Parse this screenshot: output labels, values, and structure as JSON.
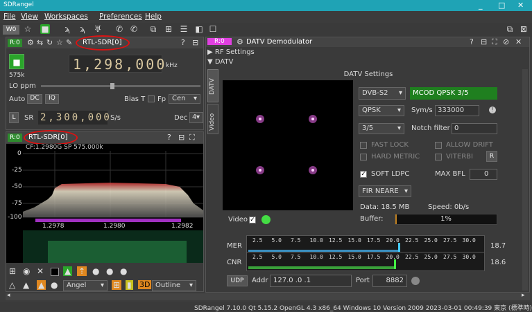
{
  "window": {
    "title": "SDRangel",
    "controls": [
      "_",
      "□",
      "✕"
    ]
  },
  "menu": [
    "File",
    "View",
    "Workspaces",
    "Preferences",
    "Help"
  ],
  "toolbar": {
    "workspace": "W0"
  },
  "device": {
    "tag": "R:0",
    "name": "RTL-SDR[0]",
    "frequency": "1,298,000",
    "unit": "kHz",
    "sample_rate_label": "575k",
    "lo_ppm_label": "LO ppm",
    "auto_label": "Auto",
    "dc_label": "DC",
    "iq_label": "IQ",
    "bias_label": "Bias T",
    "fp_label": "Fp",
    "cen_value": "Cen",
    "l_label": "L",
    "sr_label": "SR",
    "sr_value": "2,300,000",
    "sr_unit": "S/s",
    "dec_label": "Dec",
    "dec_value": "4"
  },
  "spectrum": {
    "tag": "R:0",
    "name": "RTL-SDR[0]",
    "info": "CF:1.2980G SP 575.000k",
    "y_ticks": [
      "0",
      "-25",
      "-50",
      "-75",
      "-100"
    ],
    "x_ticks": [
      "1.2978",
      "1.2980",
      "1.2982"
    ],
    "bottom_controls": {
      "angel_value": "Angel",
      "outline_value": "Outline"
    }
  },
  "datv": {
    "tag": "R:0",
    "title": "DATV Demodulator",
    "rf_settings_label": "RF Settings",
    "datv_label": "DATV",
    "settings_title": "DATV Settings",
    "side_tabs": [
      "DATV",
      "Video"
    ],
    "standard": "DVB-S2",
    "modcod": "MCOD QPSK 3/5",
    "modulation": "QPSK",
    "symrate_label": "Sym/s",
    "symrate": "333000",
    "fec": "3/5",
    "notch_label": "Notch filter",
    "notch_value": "0",
    "fast_lock": "FAST LOCK",
    "allow_drift": "ALLOW DRIFT",
    "hard_metric": "HARD METRIC",
    "viterbi": "VITERBI",
    "r_button": "R",
    "soft_ldpc": "SOFT LDPC",
    "max_bfl_label": "MAX BFL",
    "max_bfl_value": "0",
    "filter": "FIR NEARE",
    "data_label": "Data: 18.5 MB",
    "speed_label": "Speed: 0b/s",
    "buffer_label": "Buffer:",
    "buffer_value": "1%",
    "buffer_fraction": 0.01,
    "video_label": "Video",
    "scale_ticks": [
      "2.5",
      "5.0",
      "7.5",
      "10.0",
      "12.5",
      "15.0",
      "17.5",
      "20.0",
      "22.5",
      "25.0",
      "27.5",
      "30.0"
    ],
    "mer_label": "MER",
    "mer_value": "18.7",
    "cnr_label": "CNR",
    "cnr_value": "18.6",
    "udp_label": "UDP",
    "addr_label": "Addr",
    "addr_value": "127.0 .0 .1",
    "port_label": "Port",
    "port_value": "8882"
  },
  "status_bar": "SDRangel 7.10.0 Qt 5.15.2 OpenGL 4.3 x86_64 Windows 10 Version 2009  2023-03-01 00:49:39 東京 (標準時)",
  "colors": {
    "accent_magenta": "#e040e0",
    "ok_green": "#2aa52a",
    "titlebar": "#1fa3b5",
    "annotation_red": "#d11111"
  }
}
